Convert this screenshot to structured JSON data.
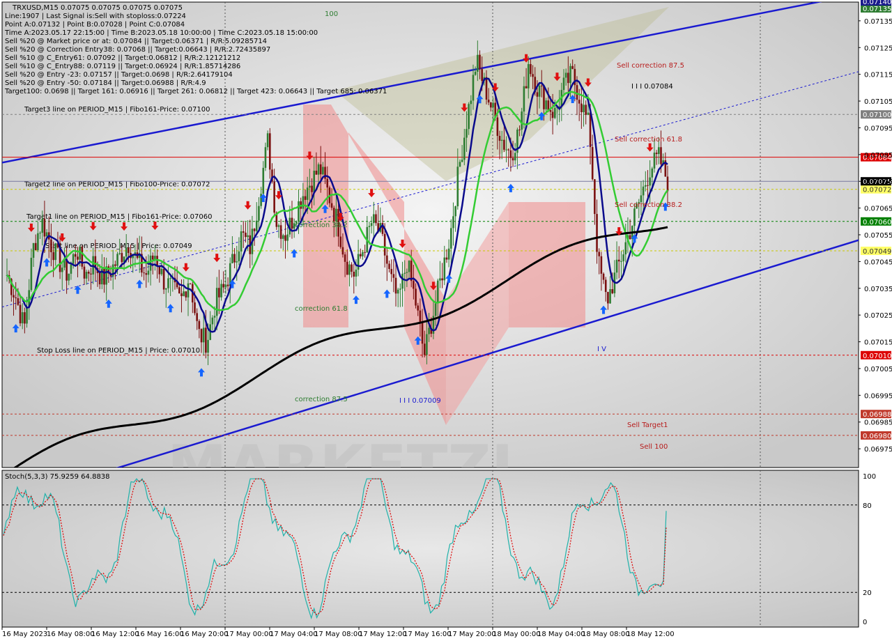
{
  "header": {
    "symbol_line": "TRXUSD,M15  0.07075 0.07075 0.07075 0.07075",
    "info_lines": [
      "Line:1907 | Last Signal is:Sell with stoploss:0.07224",
      "Point A:0.07132 | Point B:0.07028 | Point C:0.07084",
      "Time A:2023.05.17 22:15:00 | Time B:2023.05.18 10:00:00 | Time C:2023.05.18 15:00:00",
      "Sell %20 @ Market price or at: 0.07084 || Target:0.06371 | R/R:5.09285714",
      "Sell %20 @ Correction Entry38: 0.07068 || Target:0.06643 | R/R:2.72435897",
      "Sell %10 @ C_Entry61: 0.07092 || Target:0.06812 | R/R:2.12121212",
      "Sell %10 @ C_Entry88: 0.07119 || Target:0.06924 | R/R:1.85714286",
      "Sell %20 @ Entry -23: 0.07157 || Target:0.0698 | R/R:2.64179104",
      "Sell %20 @ Entry -50: 0.07184 || Target:0.06988 | R/R:4.9",
      "Target100: 0.0698 || Target 161: 0.06916 || Target 261: 0.06812 || Target 423: 0.06643 || Target 685: 0.06371"
    ]
  },
  "chart_data": {
    "type": "candlestick",
    "symbol": "TRXUSD",
    "timeframe": "M15",
    "ylim": [
      0.06968,
      0.07142
    ],
    "y_ticks": [
      "0.07135",
      "0.07125",
      "0.07115",
      "0.07105",
      "0.07095",
      "0.07085",
      "0.07075",
      "0.07065",
      "0.07055",
      "0.07045",
      "0.07035",
      "0.07025",
      "0.07015",
      "0.07005",
      "0.06995",
      "0.06985",
      "0.06975"
    ],
    "x_ticks": [
      "16 May 2023",
      "16 May 08:00",
      "16 May 12:00",
      "16 May 16:00",
      "16 May 20:00",
      "17 May 00:00",
      "17 May 04:00",
      "17 May 08:00",
      "17 May 12:00",
      "17 May 16:00",
      "17 May 20:00",
      "18 May 00:00",
      "18 May 04:00",
      "18 May 08:00",
      "18 May 12:00"
    ],
    "price_path": [
      0.0704,
      0.07032,
      0.0702,
      0.0705,
      0.0706,
      0.07052,
      0.07045,
      0.0704,
      0.0705,
      0.0704,
      0.07045,
      0.07038,
      0.07042,
      0.07047,
      0.07052,
      0.07045,
      0.0704,
      0.07048,
      0.07038,
      0.07035,
      0.0703,
      0.0704,
      0.07018,
      0.07015,
      0.0703,
      0.07035,
      0.07045,
      0.07055,
      0.0705,
      0.0707,
      0.0709,
      0.0706,
      0.07055,
      0.07062,
      0.0707,
      0.07075,
      0.0708,
      0.0707,
      0.0706,
      0.07045,
      0.0704,
      0.0705,
      0.0706,
      0.07055,
      0.0704,
      0.0703,
      0.07045,
      0.0703,
      0.0701,
      0.07025,
      0.0704,
      0.07055,
      0.0708,
      0.071,
      0.0712,
      0.0711,
      0.071,
      0.0709,
      0.07085,
      0.07095,
      0.0712,
      0.0711,
      0.07105,
      0.071,
      0.0711,
      0.07115,
      0.07105,
      0.07095,
      0.07045,
      0.0703,
      0.0704,
      0.0705,
      0.0706,
      0.0707,
      0.0708,
      0.07084,
      0.07075
    ],
    "channel_upper": [
      0.07082,
      0.07145
    ],
    "channel_lower": [
      0.06965,
      0.07053
    ],
    "dotted_channel": [
      0.07028,
      0.07116
    ],
    "levels": [
      {
        "name": "Target3 line on PERIOD_M15 | Fibo161-Price: 0.07100",
        "price": 0.071,
        "tag": "0.07100",
        "color": "#808080",
        "tagbg": "#808080"
      },
      {
        "name": "",
        "price": 0.07084,
        "tag": "0.07084",
        "color": "#dd0000",
        "tagbg": "#dd0000"
      },
      {
        "name": "Target2 line on PERIOD_M15 | Fibo100-Price: 0.07072",
        "price": 0.07072,
        "tag": "0.07072",
        "color": "#c8c800",
        "tagbg": "#ffff66"
      },
      {
        "name": "Target1 line on PERIOD_M15 | Fibo161-Price: 0.07060",
        "price": 0.0706,
        "tag": "0.07060",
        "color": "#008000",
        "tagbg": "#008000"
      },
      {
        "name": "Start line on PERIOD_M15 | Price: 0.07049",
        "price": 0.07049,
        "tag": "0.07049",
        "color": "#c8c800",
        "tagbg": "#ffff66"
      },
      {
        "name": "Stop Loss line on PERIOD_M15 | Price: 0.07010",
        "price": 0.0701,
        "tag": "0.07010",
        "color": "#dd0000",
        "tagbg": "#dd0000"
      },
      {
        "name": "",
        "price": 0.06988,
        "tag": "0.06988",
        "color": "#c0392b",
        "tagbg": "#c0392b"
      },
      {
        "name": "",
        "price": 0.0698,
        "tag": "0.06980",
        "color": "#c0392b",
        "tagbg": "#c0392b"
      }
    ],
    "current_price": "0.07075",
    "top_tags": [
      "0.07140",
      "0.07135"
    ],
    "annotations": [
      {
        "text": "100",
        "color": "#2e7d32"
      },
      {
        "text": "Sell correction 87.5",
        "color": "#b71c1c"
      },
      {
        "text": "I I I 0.07084",
        "color": "#000000"
      },
      {
        "text": "Sell correction 61.8",
        "color": "#b71c1c"
      },
      {
        "text": "Sell correction 38.2",
        "color": "#b71c1c"
      },
      {
        "text": "correction 38.2",
        "color": "#2e7d32"
      },
      {
        "text": "correction 61.8",
        "color": "#2e7d32"
      },
      {
        "text": "correction 87.5",
        "color": "#2e7d32"
      },
      {
        "text": "I I I 0.07009",
        "color": "#1a1ad0"
      },
      {
        "text": "I V",
        "color": "#1a1ad0"
      },
      {
        "text": "Sell Target1",
        "color": "#b71c1c"
      },
      {
        "text": "Sell 100",
        "color": "#b71c1c"
      }
    ],
    "indicator": {
      "label": "Stoch(5,3,3) 75.9259 64.8838",
      "main_value": 75.9259,
      "signal_value": 64.8838,
      "ylim": [
        0,
        100
      ],
      "levels": [
        80,
        20
      ],
      "y_ticks": [
        "100",
        "80",
        "20",
        "0"
      ]
    },
    "colors": {
      "ma_fast": "#0a0a8c",
      "ma_mid": "#33cc33",
      "ma_slow": "#000000",
      "channel": "#1a1ad0",
      "bull": "#2e7d32",
      "bear": "#7a1010",
      "stoch_main": "#20b2aa",
      "stoch_signal": "#dd0000"
    }
  }
}
